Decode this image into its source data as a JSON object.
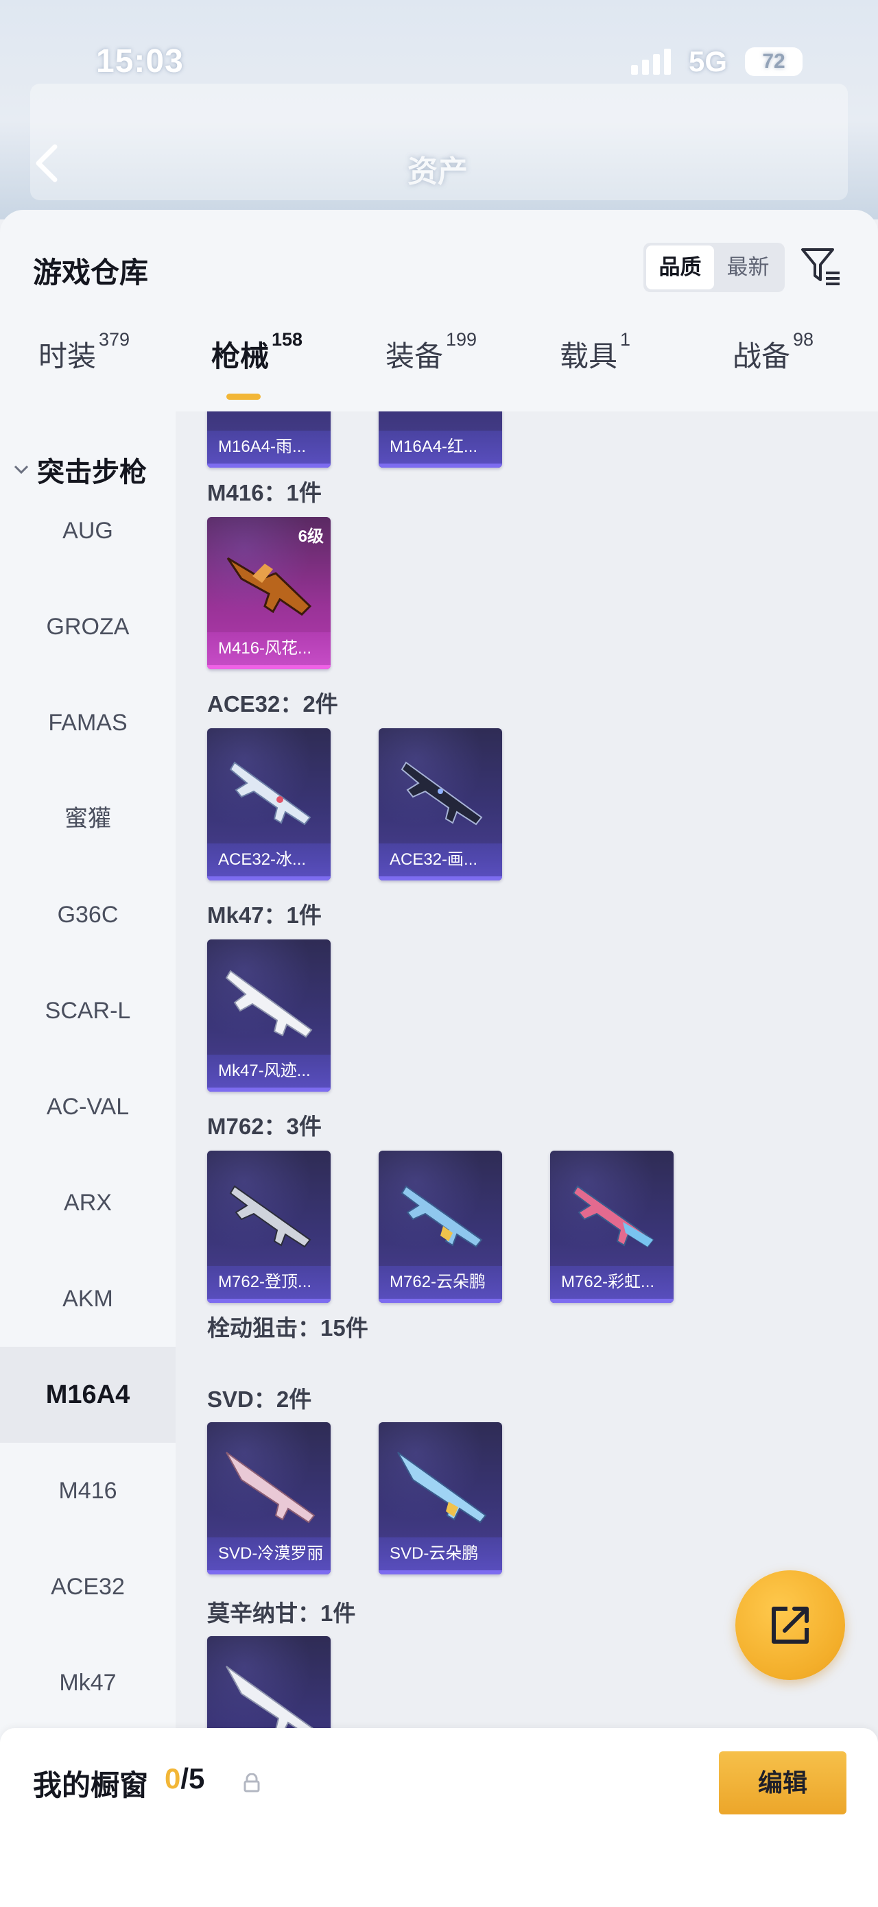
{
  "status_bar": {
    "time": "15:03",
    "network": "5G",
    "battery": "72"
  },
  "header": {
    "title": "资产"
  },
  "panel": {
    "title": "游戏仓库",
    "sort_options": [
      "品质",
      "最新"
    ],
    "sort_selected": "品质"
  },
  "tabs": [
    {
      "label": "时装",
      "count": "379"
    },
    {
      "label": "枪械",
      "count": "158"
    },
    {
      "label": "装备",
      "count": "199"
    },
    {
      "label": "载具",
      "count": "1"
    },
    {
      "label": "战备",
      "count": "98"
    }
  ],
  "active_tab": "枪械",
  "sidebar": {
    "group": "突击步枪",
    "items": [
      "AUG",
      "GROZA",
      "FAMAS",
      "蜜獾",
      "G36C",
      "SCAR-L",
      "AC-VAL",
      "ARX",
      "AKM",
      "M16A4",
      "M416",
      "ACE32",
      "Mk47"
    ],
    "active": "M16A4"
  },
  "sections": [
    {
      "label": "",
      "items": [
        "M16A4-雨...",
        "M16A4-红..."
      ]
    },
    {
      "label": "M416：1件",
      "items": [
        {
          "name": "M416-风花...",
          "level": "6级"
        }
      ]
    },
    {
      "label": "ACE32：2件",
      "items": [
        "ACE32-冰...",
        "ACE32-画..."
      ]
    },
    {
      "label": "Mk47：1件",
      "items": [
        "Mk47-风迹..."
      ]
    },
    {
      "label": "M762：3件",
      "items": [
        "M762-登顶...",
        "M762-云朵鹏",
        "M762-彩虹..."
      ]
    },
    {
      "label": "栓动狙击：15件",
      "items": []
    },
    {
      "label": "SVD：2件",
      "items": [
        "SVD-冷漠罗丽",
        "SVD-云朵鹏"
      ]
    },
    {
      "label": "莫辛纳甘：1件",
      "items": [
        ""
      ]
    }
  ],
  "showcase": {
    "title": "我的橱窗",
    "count_current": "0",
    "count_total": "/5",
    "edit_label": "编辑"
  },
  "colors": {
    "accent": "#f2b637",
    "card_purple": "#3a3577",
    "card_legend": "#9a3398"
  },
  "icons": [
    "back-icon",
    "filter-icon",
    "chevron-down-icon",
    "share-icon",
    "lock-icon",
    "signal-icon",
    "battery-icon"
  ]
}
